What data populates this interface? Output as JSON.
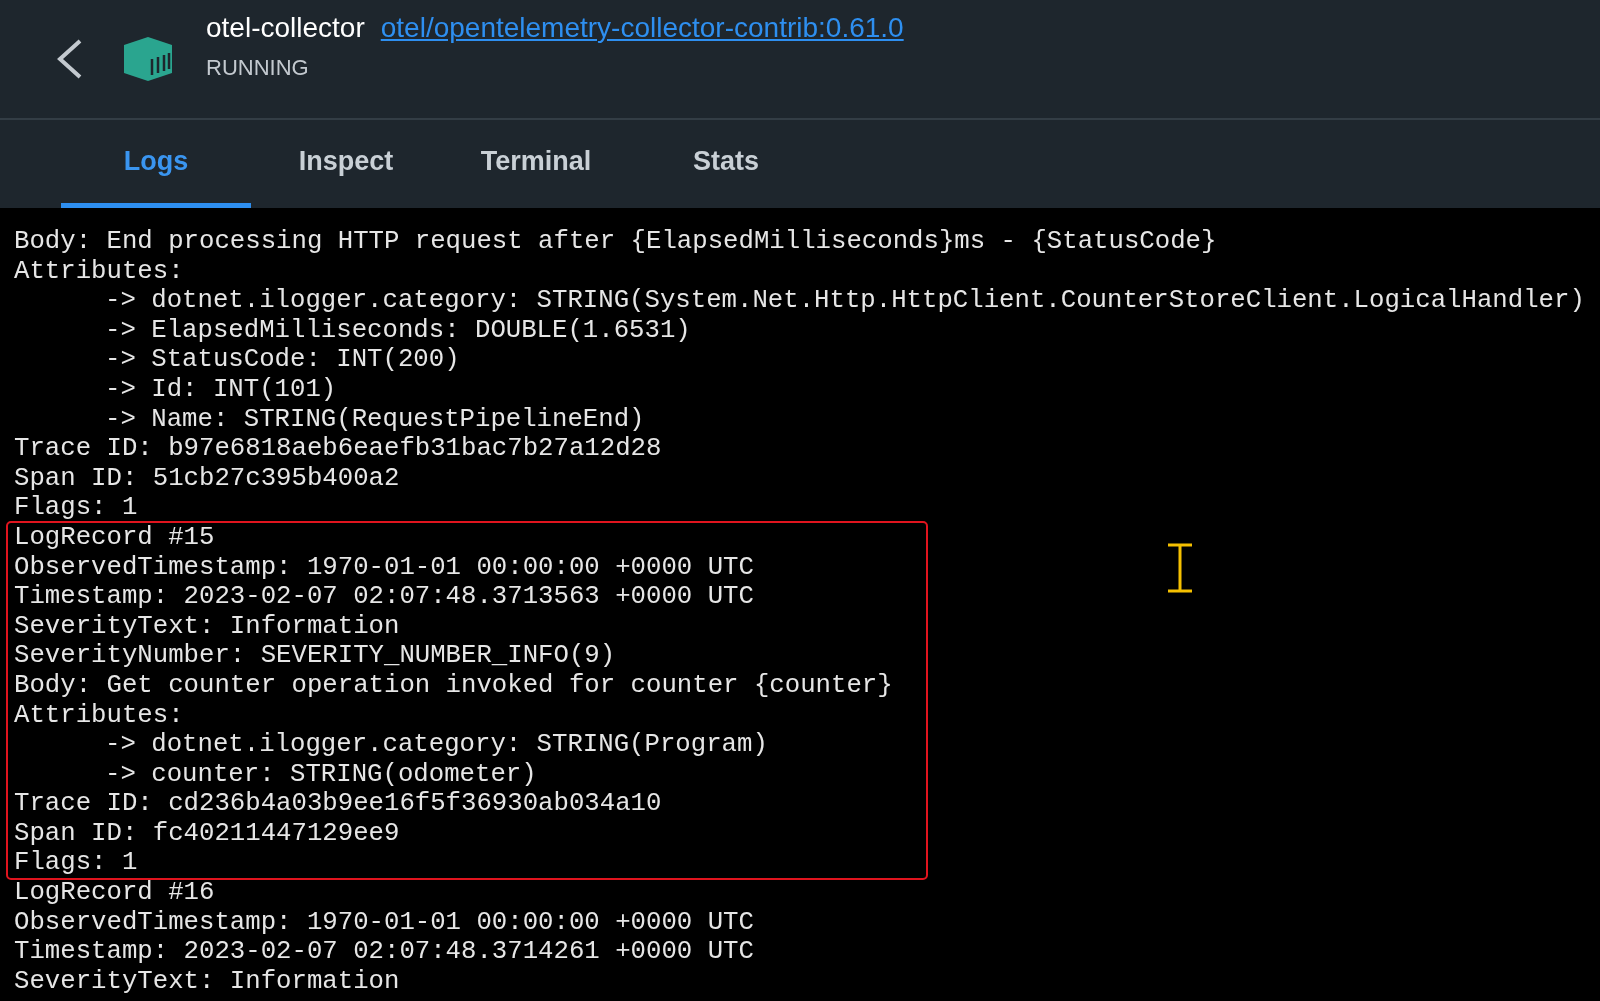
{
  "container": {
    "name": "otel-collector",
    "image": "otel/opentelemetry-collector-contrib:0.61.0",
    "status": "RUNNING"
  },
  "tabs": [
    {
      "label": "Logs",
      "selected": true
    },
    {
      "label": "Inspect",
      "selected": false
    },
    {
      "label": "Terminal",
      "selected": false
    },
    {
      "label": "Stats",
      "selected": false
    }
  ],
  "log_groups": [
    {
      "highlighted": false,
      "lines": [
        {
          "kind": "field",
          "text": "Body: End processing HTTP request after {ElapsedMilliseconds}ms - {StatusCode}"
        },
        {
          "kind": "field",
          "text": "Attributes:"
        },
        {
          "kind": "attribute",
          "text": "-> dotnet.ilogger.category: STRING(System.Net.Http.HttpClient.CounterStoreClient.LogicalHandler)"
        },
        {
          "kind": "attribute",
          "text": "-> ElapsedMilliseconds: DOUBLE(1.6531)"
        },
        {
          "kind": "attribute",
          "text": "-> StatusCode: INT(200)"
        },
        {
          "kind": "attribute",
          "text": "-> Id: INT(101)"
        },
        {
          "kind": "attribute",
          "text": "-> Name: STRING(RequestPipelineEnd)"
        },
        {
          "kind": "field",
          "text": "Trace ID: b97e6818aeb6eaefb31bac7b27a12d28"
        },
        {
          "kind": "field",
          "text": "Span ID: 51cb27c395b400a2"
        },
        {
          "kind": "field",
          "text": "Flags: 1"
        }
      ]
    },
    {
      "highlighted": true,
      "lines": [
        {
          "kind": "field",
          "text": "LogRecord #15"
        },
        {
          "kind": "field",
          "text": "ObservedTimestamp: 1970-01-01 00:00:00 +0000 UTC"
        },
        {
          "kind": "field",
          "text": "Timestamp: 2023-02-07 02:07:48.3713563 +0000 UTC"
        },
        {
          "kind": "field",
          "text": "SeverityText: Information"
        },
        {
          "kind": "field",
          "text": "SeverityNumber: SEVERITY_NUMBER_INFO(9)"
        },
        {
          "kind": "field",
          "text": "Body: Get counter operation invoked for counter {counter}"
        },
        {
          "kind": "field",
          "text": "Attributes:"
        },
        {
          "kind": "attribute",
          "text": "-> dotnet.ilogger.category: STRING(Program)"
        },
        {
          "kind": "attribute",
          "text": "-> counter: STRING(odometer)"
        },
        {
          "kind": "field",
          "text": "Trace ID: cd236b4a03b9ee16f5f36930ab034a10"
        },
        {
          "kind": "field",
          "text": "Span ID: fc40211447129ee9"
        },
        {
          "kind": "field",
          "text": "Flags: 1"
        }
      ]
    },
    {
      "highlighted": false,
      "lines": [
        {
          "kind": "field",
          "text": "LogRecord #16"
        },
        {
          "kind": "field",
          "text": "ObservedTimestamp: 1970-01-01 00:00:00 +0000 UTC"
        },
        {
          "kind": "field",
          "text": "Timestamp: 2023-02-07 02:07:48.3714261 +0000 UTC"
        },
        {
          "kind": "field",
          "text": "SeverityText: Information"
        }
      ]
    }
  ]
}
